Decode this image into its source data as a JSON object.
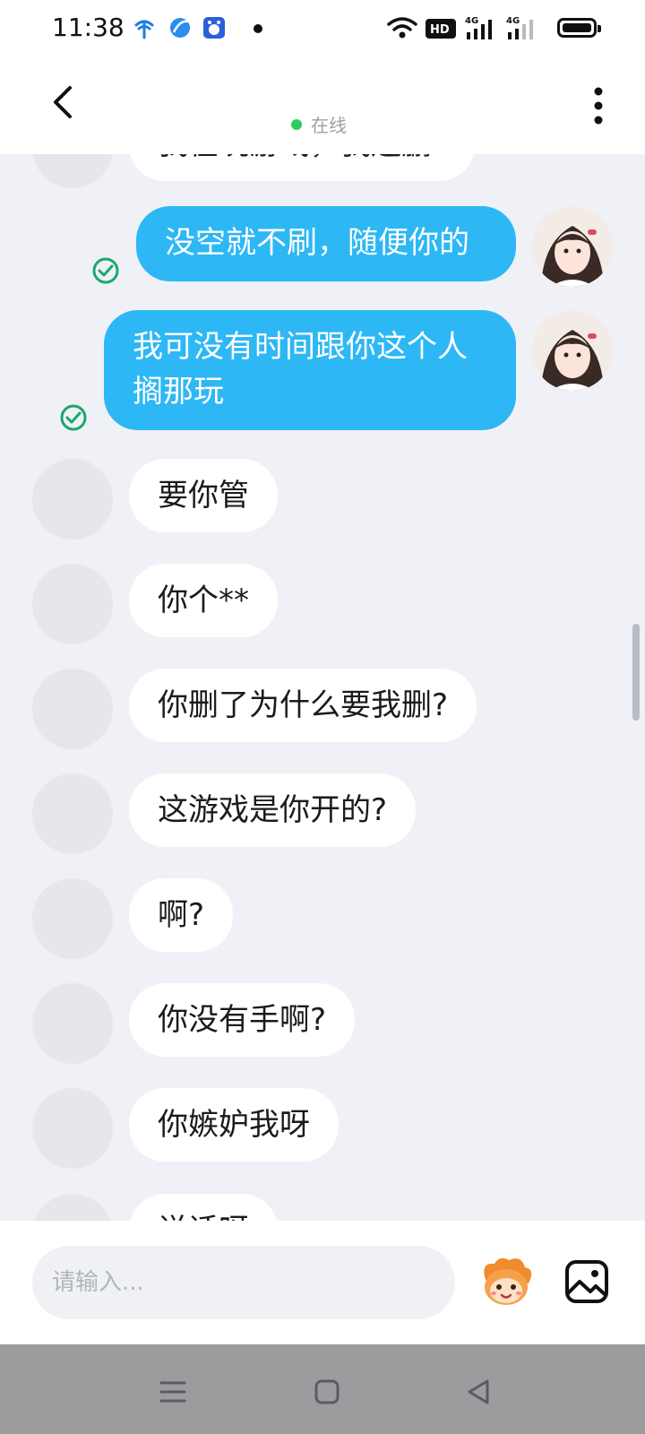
{
  "status_bar": {
    "time": "11:38",
    "network_a": "4G",
    "network_b": "4G",
    "hd_label": "HD"
  },
  "header": {
    "status": "在线",
    "status_color": "#2fcb5c"
  },
  "messages": [
    {
      "side": "in",
      "text": "我在玩游戏，我还删"
    },
    {
      "side": "out",
      "text": "没空就不刷，随便你的",
      "status": "read"
    },
    {
      "side": "out",
      "text": "我可没有时间跟你这个人搁那玩",
      "status": "read"
    },
    {
      "side": "in",
      "text": "要你管"
    },
    {
      "side": "in",
      "text": "你个**"
    },
    {
      "side": "in",
      "text": "你删了为什么要我删?"
    },
    {
      "side": "in",
      "text": "这游戏是你开的?"
    },
    {
      "side": "in",
      "text": "啊?"
    },
    {
      "side": "in",
      "text": "你没有手啊?"
    },
    {
      "side": "in",
      "text": "你嫉妒我呀"
    },
    {
      "side": "in",
      "text": "说话呀"
    }
  ],
  "input": {
    "placeholder": "请输入..."
  },
  "colors": {
    "out_bubble": "#2db7f5",
    "in_bubble": "#ffffff",
    "background": "#eff1f6",
    "check": "#1aa86b"
  },
  "icons": [
    "back-arrow-icon",
    "more-vertical-icon",
    "emoji-mascot-icon",
    "image-icon",
    "nav-menu-icon",
    "nav-home-icon",
    "nav-back-icon"
  ]
}
